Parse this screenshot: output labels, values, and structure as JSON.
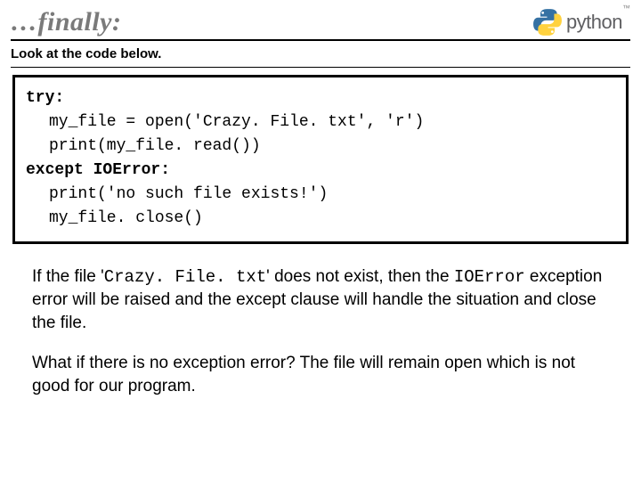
{
  "header": {
    "title": "…finally:",
    "logo_text": "python",
    "logo_tm": "™"
  },
  "subtitle": "Look at the code below.",
  "code": {
    "l1_kw": "try:",
    "l2": "my_file = open('Crazy. File. txt', 'r')",
    "l3": "print(my_file. read())",
    "l4_kw": "except IOError:",
    "l5": "print('no such file exists!')",
    "l6": "my_file. close()"
  },
  "explain": {
    "p1a": "If the file '",
    "p1_file": "Crazy. File. txt",
    "p1b": "' does not exist, then the ",
    "p1_err": "IOError",
    "p1c": " exception error will be raised and the except clause will handle the situation and close the file.",
    "p2": "What if there is no exception error?  The file will remain open which is not good for our program."
  }
}
